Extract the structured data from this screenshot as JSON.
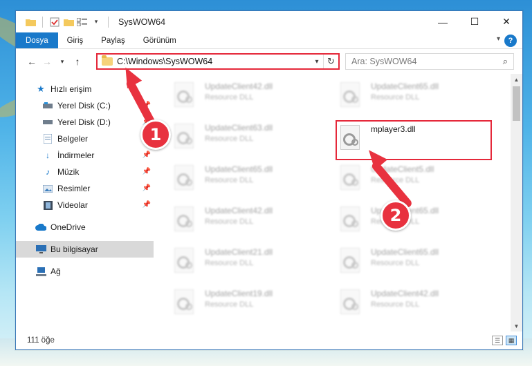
{
  "window": {
    "title": "SysWOW64",
    "controls": {
      "minimize": "—",
      "maximize": "☐",
      "close": "✕"
    }
  },
  "ribbon": {
    "tabs": [
      {
        "label": "Dosya",
        "active": true
      },
      {
        "label": "Giriş",
        "active": false
      },
      {
        "label": "Paylaş",
        "active": false
      },
      {
        "label": "Görünüm",
        "active": false
      }
    ]
  },
  "nav": {
    "address": "C:\\Windows\\SysWOW64",
    "search_placeholder": "Ara: SysWOW64"
  },
  "sidebar": {
    "items": [
      {
        "label": "Hızlı erişim",
        "icon": "star-icon",
        "level": 1,
        "pinned": false
      },
      {
        "label": "Yerel Disk (C:)",
        "icon": "drive-icon",
        "level": 2,
        "pinned": true
      },
      {
        "label": "Yerel Disk (D:)",
        "icon": "drive-icon",
        "level": 2,
        "pinned": true
      },
      {
        "label": "Belgeler",
        "icon": "documents-icon",
        "level": 2,
        "pinned": true
      },
      {
        "label": "İndirmeler",
        "icon": "download-icon",
        "level": 2,
        "pinned": true
      },
      {
        "label": "Müzik",
        "icon": "music-icon",
        "level": 2,
        "pinned": true
      },
      {
        "label": "Resimler",
        "icon": "pictures-icon",
        "level": 2,
        "pinned": true
      },
      {
        "label": "Videolar",
        "icon": "videos-icon",
        "level": 2,
        "pinned": true
      },
      {
        "label": "OneDrive",
        "icon": "cloud-icon",
        "level": 1,
        "pinned": false
      },
      {
        "label": "Bu bilgisayar",
        "icon": "computer-icon",
        "level": 1,
        "pinned": false,
        "selected": true
      },
      {
        "label": "Ağ",
        "icon": "network-icon",
        "level": 1,
        "pinned": false
      }
    ]
  },
  "files": {
    "left": [
      {
        "name": "UpdateClient42.dll",
        "desc": "Resource DLL"
      },
      {
        "name": "UpdateClient63.dll",
        "desc": "Resource DLL"
      },
      {
        "name": "UpdateClient65.dll",
        "desc": "Resource DLL"
      },
      {
        "name": "UpdateClient42.dll",
        "desc": "Resource DLL"
      },
      {
        "name": "UpdateClient21.dll",
        "desc": "Resource DLL"
      },
      {
        "name": "UpdateClient19.dll",
        "desc": "Resource DLL"
      }
    ],
    "right": [
      {
        "name": "UpdateClient65.dll",
        "desc": "Resource DLL",
        "highlight": false
      },
      {
        "name": "mplayer3.dll",
        "desc": "",
        "highlight": true
      },
      {
        "name": "UpdateClient5.dll",
        "desc": "Resource DLL",
        "highlight": false
      },
      {
        "name": "UpdateClient65.dll",
        "desc": "Resource DLL",
        "highlight": false
      },
      {
        "name": "UpdateClient65.dll",
        "desc": "Resource DLL",
        "highlight": false
      },
      {
        "name": "UpdateClient42.dll",
        "desc": "Resource DLL",
        "highlight": false
      }
    ]
  },
  "status": {
    "count": "111 öğe"
  },
  "annotations": {
    "step1": "1",
    "step2": "2",
    "color": "#e8323f"
  },
  "colors": {
    "accent": "#1979ca",
    "highlight": "#e5283a"
  }
}
